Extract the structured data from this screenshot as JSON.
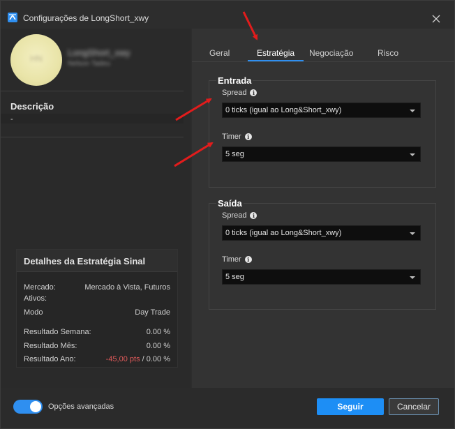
{
  "window": {
    "title": "Configurações de LongShort_xwy",
    "accent": "#2f8ff0"
  },
  "profile": {
    "avatar_initials": "HN",
    "name": "LongShort_xwy",
    "subtitle": "Nelson Tadeu"
  },
  "description": {
    "title": "Descrição",
    "value": "-"
  },
  "details": {
    "title": "Detalhes da Estratégia Sinal",
    "rows": [
      {
        "key": "Mercado:",
        "value": "Mercado à Vista, Futuros"
      },
      {
        "key": "Ativos:",
        "value": ""
      },
      {
        "key": "Modo",
        "value": "Day Trade"
      },
      {
        "key": "Resultado Semana:",
        "value": "0.00 %"
      },
      {
        "key": "Resultado Mês:",
        "value": "0.00 %"
      },
      {
        "key": "Resultado Ano:",
        "value_pts": "-45,00 pts",
        "value_sep": " / ",
        "value": "0.00 %"
      }
    ]
  },
  "tabs": [
    {
      "label": "Geral",
      "active": false
    },
    {
      "label": "Estratégia",
      "active": true
    },
    {
      "label": "Negociação",
      "active": false
    },
    {
      "label": "Risco",
      "active": false
    }
  ],
  "entrada": {
    "title": "Entrada",
    "spread_label": "Spread",
    "spread_value": "0 ticks (igual ao Long&Short_xwy)",
    "timer_label": "Timer",
    "timer_value": "5 seg"
  },
  "saida": {
    "title": "Saída",
    "spread_label": "Spread",
    "spread_value": "0 ticks (igual ao Long&Short_xwy)",
    "timer_label": "Timer",
    "timer_value": "5 seg"
  },
  "footer": {
    "advanced_label": "Opções avançadas",
    "advanced_on": true,
    "primary_label": "Seguir",
    "secondary_label": "Cancelar"
  },
  "icons": {
    "app": "app-logo-icon",
    "close": "close-icon",
    "info": "info-icon",
    "dropdown": "chevron-down-icon"
  },
  "colors": {
    "negative": "#e05a5a",
    "primary_button": "#1d8ef5",
    "annotation_arrow": "#e21c1c"
  }
}
